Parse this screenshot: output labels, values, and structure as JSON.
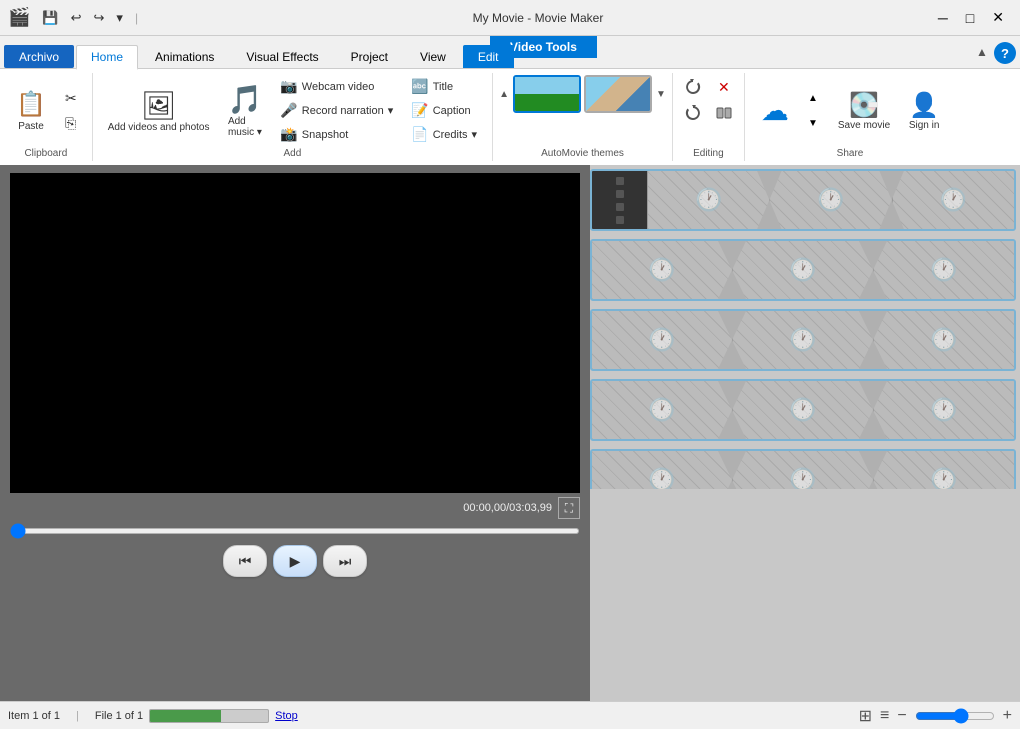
{
  "titlebar": {
    "logo": "🎬",
    "title": "My Movie - Movie Maker",
    "qat": {
      "save": "💾",
      "undo": "↩",
      "redo": "↪",
      "customize": "▾"
    },
    "controls": {
      "minimize": "─",
      "maximize": "□",
      "close": "✕"
    }
  },
  "video_tools": {
    "label": "Video Tools"
  },
  "ribbon": {
    "tabs": [
      {
        "id": "archivo",
        "label": "Archivo"
      },
      {
        "id": "home",
        "label": "Home",
        "active": true
      },
      {
        "id": "animations",
        "label": "Animations"
      },
      {
        "id": "visual_effects",
        "label": "Visual Effects"
      },
      {
        "id": "project",
        "label": "Project"
      },
      {
        "id": "view",
        "label": "View"
      },
      {
        "id": "edit",
        "label": "Edit",
        "highlighted": true
      }
    ],
    "groups": {
      "clipboard": {
        "label": "Clipboard",
        "paste": "Paste"
      },
      "add": {
        "label": "Add",
        "add_videos": "Add videos\nand photos",
        "add_music": "Add\nmusic",
        "webcam_video": "Webcam video",
        "record_narration": "Record narration",
        "snapshot": "Snapshot",
        "title": "Title",
        "caption": "Caption",
        "credits": "Credits"
      },
      "automovie": {
        "label": "AutoMovie themes"
      },
      "editing": {
        "label": "Editing"
      },
      "share": {
        "label": "Share",
        "save_movie": "Save\nmovie",
        "sign_in": "Sign\nin"
      }
    }
  },
  "preview": {
    "time_current": "00:00,00",
    "time_total": "03:03,99"
  },
  "controls": {
    "prev_frame": "⏮",
    "play": "▶",
    "next_frame": "⏭"
  },
  "timeline": {
    "strips": [
      {
        "id": 1,
        "frames": 3
      },
      {
        "id": 2,
        "frames": 3
      },
      {
        "id": 3,
        "frames": 3
      },
      {
        "id": 4,
        "frames": 3
      },
      {
        "id": 5,
        "frames": 3,
        "partial": true
      }
    ]
  },
  "statusbar": {
    "item_info": "Item 1 of 1",
    "file_info": "File 1 of 1",
    "stop_label": "Stop",
    "zoom_in": "+",
    "zoom_out": "−"
  }
}
